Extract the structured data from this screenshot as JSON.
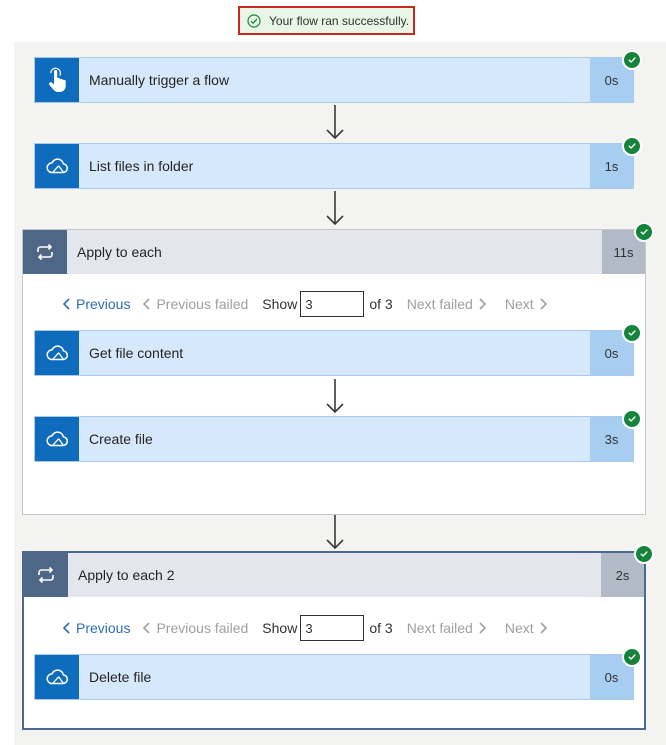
{
  "banner": {
    "message": "Your flow ran successfully.",
    "icon": "check-circle-icon"
  },
  "steps": [
    {
      "label": "Manually trigger a flow",
      "duration": "0s",
      "icon": "touch-icon"
    },
    {
      "label": "List files in folder",
      "duration": "1s",
      "icon": "onedrive-icon"
    }
  ],
  "apply_each_1": {
    "label": "Apply to each",
    "duration": "11s",
    "icon": "loop-icon",
    "pager": {
      "previous": "Previous",
      "previous_failed": "Previous failed",
      "show": "Show",
      "current": "3",
      "of": "of 3",
      "next_failed": "Next failed",
      "next": "Next"
    },
    "actions": [
      {
        "label": "Get file content",
        "duration": "0s",
        "icon": "onedrive-icon"
      },
      {
        "label": "Create file",
        "duration": "3s",
        "icon": "onedrive-icon"
      }
    ]
  },
  "apply_each_2": {
    "label": "Apply to each 2",
    "duration": "2s",
    "icon": "loop-icon",
    "pager": {
      "previous": "Previous",
      "previous_failed": "Previous failed",
      "show": "Show",
      "current": "3",
      "of": "of 3",
      "next_failed": "Next failed",
      "next": "Next"
    },
    "actions": [
      {
        "label": "Delete file",
        "duration": "0s",
        "icon": "onedrive-icon"
      }
    ]
  },
  "colors": {
    "accent": "#0f6cbd",
    "success": "#14843a",
    "scope_header": "#4f6786",
    "banner_border": "#c42b1c"
  }
}
